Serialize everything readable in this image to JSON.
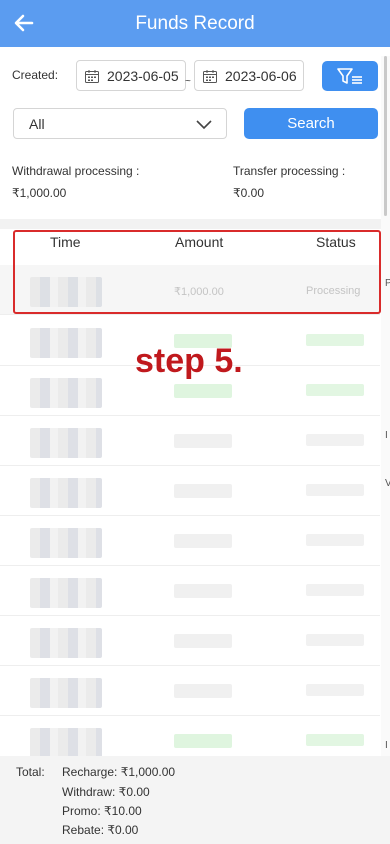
{
  "header": {
    "title": "Funds Record",
    "back_icon": "arrow-left-icon"
  },
  "filters": {
    "created_label": "Created:",
    "start_date": "2023-06-05",
    "separator": "~",
    "end_date": "2023-06-06",
    "type_select": "All",
    "search_label": "Search"
  },
  "summary": {
    "withdrawal_label": "Withdrawal processing :",
    "withdrawal_value": "₹1,000.00",
    "transfer_label": "Transfer processing :",
    "transfer_value": "₹0.00"
  },
  "table": {
    "columns": [
      "Time",
      "Amount",
      "Status"
    ],
    "first_row": {
      "amount": "₹1,000.00",
      "status": "Processing"
    }
  },
  "annotation": "step 5.",
  "edge_chars": [
    "P",
    "I",
    "V",
    "I"
  ],
  "footer": {
    "total_label": "Total:",
    "recharge": "Recharge: ₹1,000.00",
    "withdraw": "Withdraw: ₹0.00",
    "promo": "Promo: ₹10.00",
    "rebate": "Rebate: ₹0.00"
  },
  "colors": {
    "header": "#5b9cf0",
    "button": "#3f8ff0",
    "highlight": "#d92b2b"
  }
}
